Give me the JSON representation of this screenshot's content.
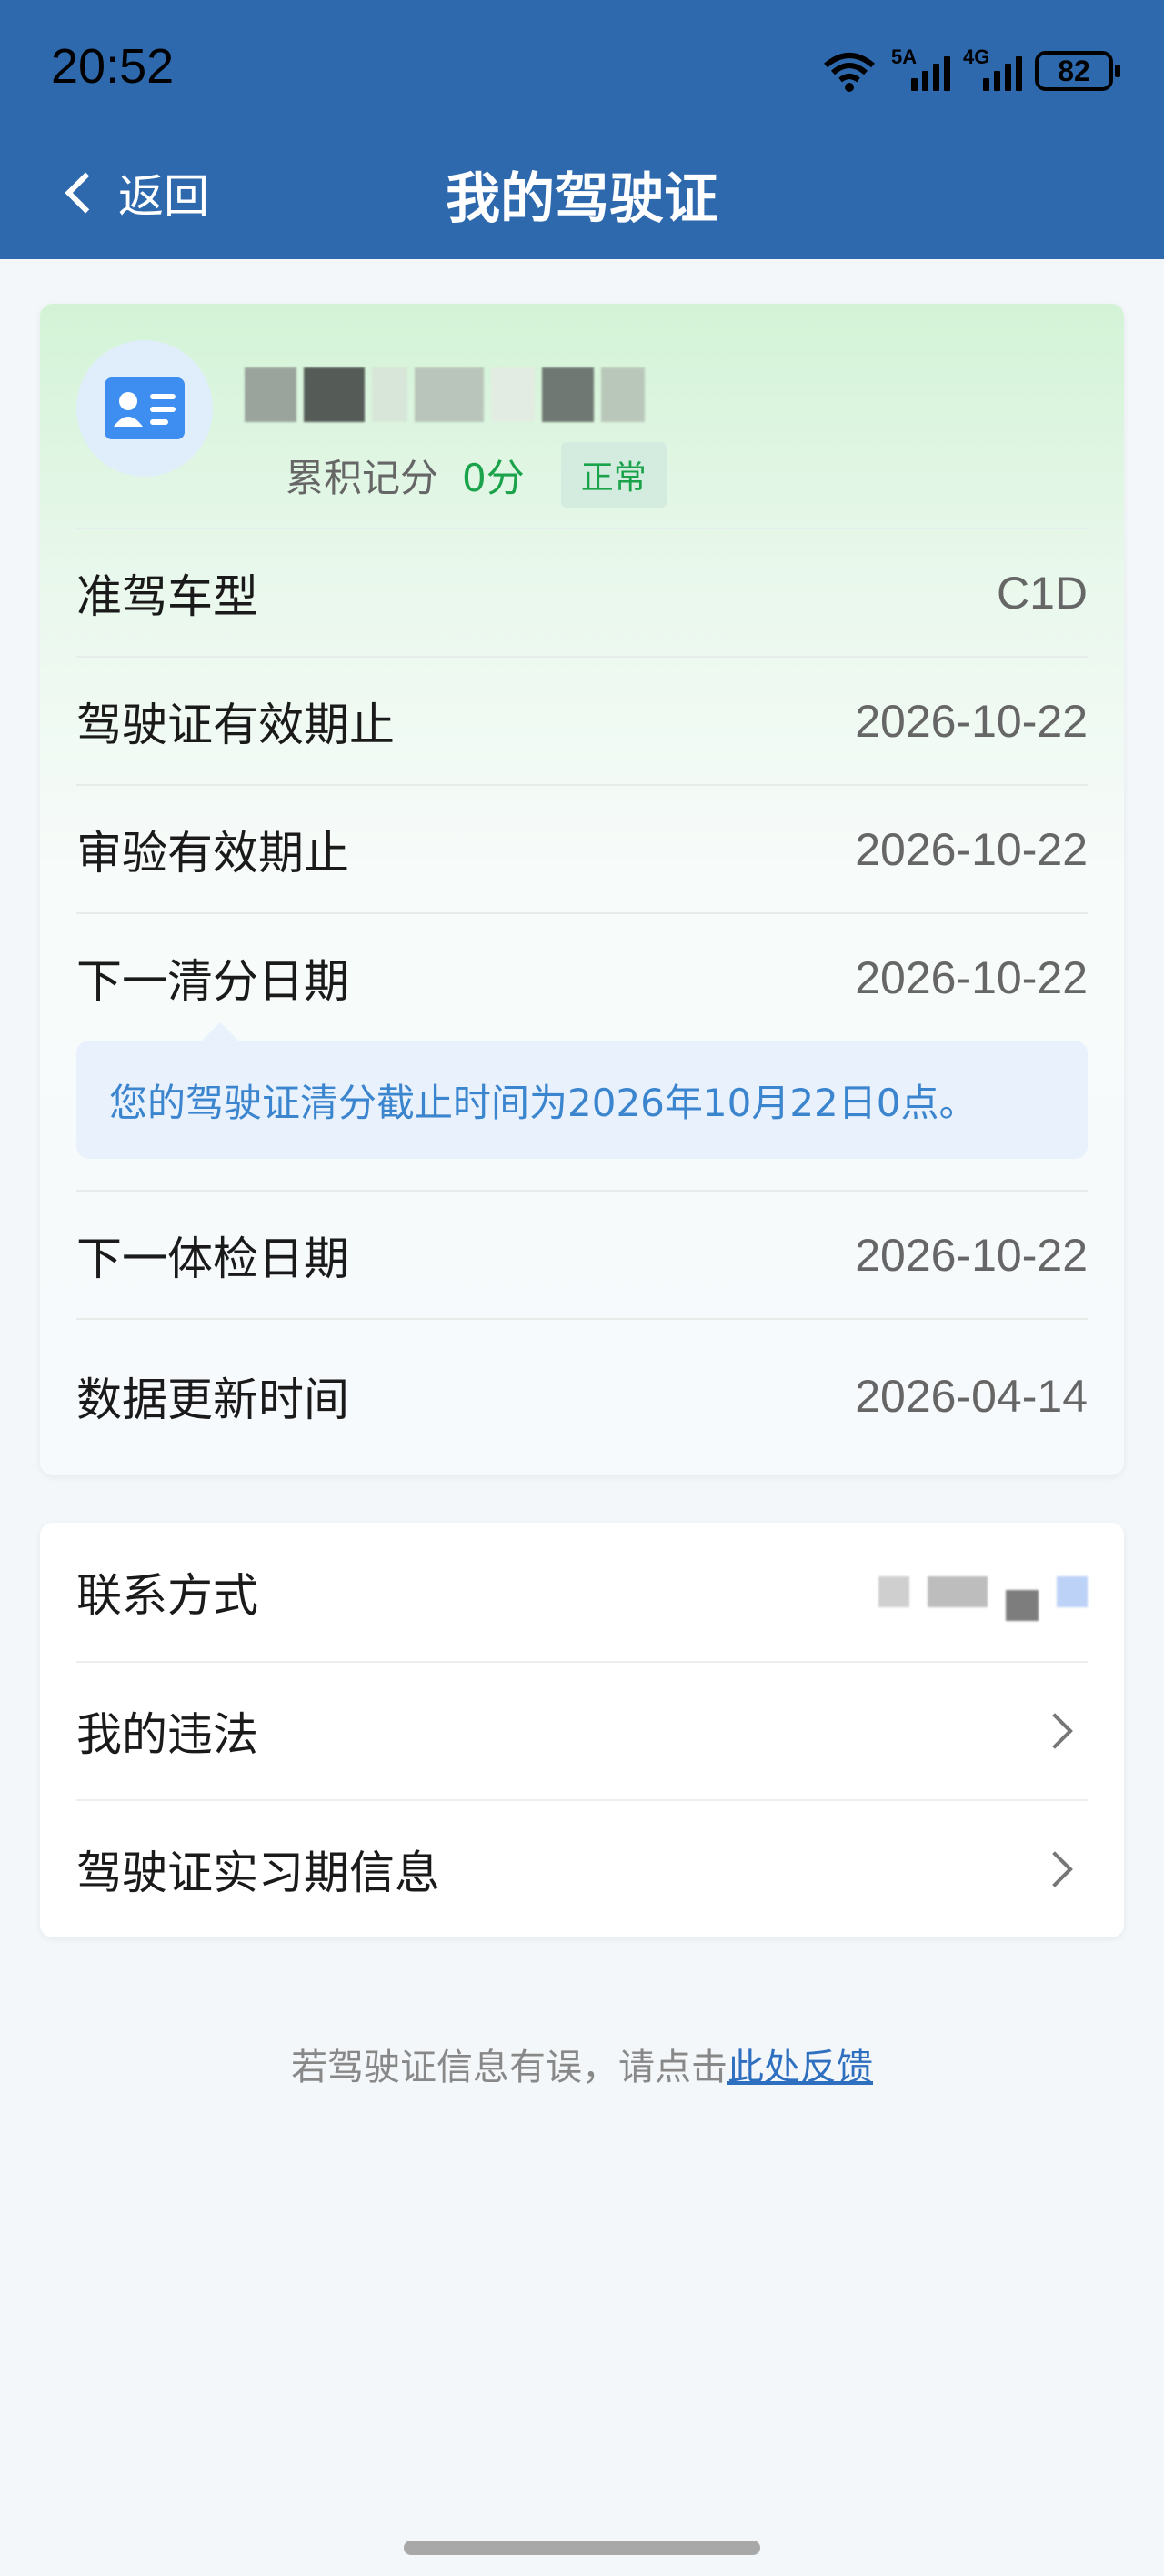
{
  "status_bar": {
    "time": "20:52",
    "network_1": "5A",
    "network_2": "4G",
    "wifi_tag": "6",
    "battery": "82"
  },
  "header": {
    "back_label": "返回",
    "title": "我的驾驶证"
  },
  "profile": {
    "icon": "license-card-icon",
    "points_label": "累积记分",
    "points_value": "0分",
    "status": "正常",
    "status_color": "#1aa34a"
  },
  "info_rows": [
    {
      "label": "准驾车型",
      "value": "C1D"
    },
    {
      "label": "驾驶证有效期止",
      "value": "2026-10-22"
    },
    {
      "label": "审验有效期止",
      "value": "2026-10-22"
    },
    {
      "label": "下一清分日期",
      "value": "2026-10-22"
    },
    {
      "label": "下一体检日期",
      "value": "2026-10-22"
    },
    {
      "label": "数据更新时间",
      "value": "2026-04-14"
    }
  ],
  "clear_tip": "您的驾驶证清分截止时间为2026年10月22日0点。",
  "links": {
    "contact": "联系方式",
    "violations": "我的违法",
    "probation": "驾驶证实习期信息"
  },
  "footer": {
    "text": "若驾驶证信息有误，请点击",
    "link": "此处反馈"
  },
  "colors": {
    "header_bg": "#2e69ae",
    "accent_blue": "#2f6fc0",
    "tip_text": "#3b85cf"
  }
}
